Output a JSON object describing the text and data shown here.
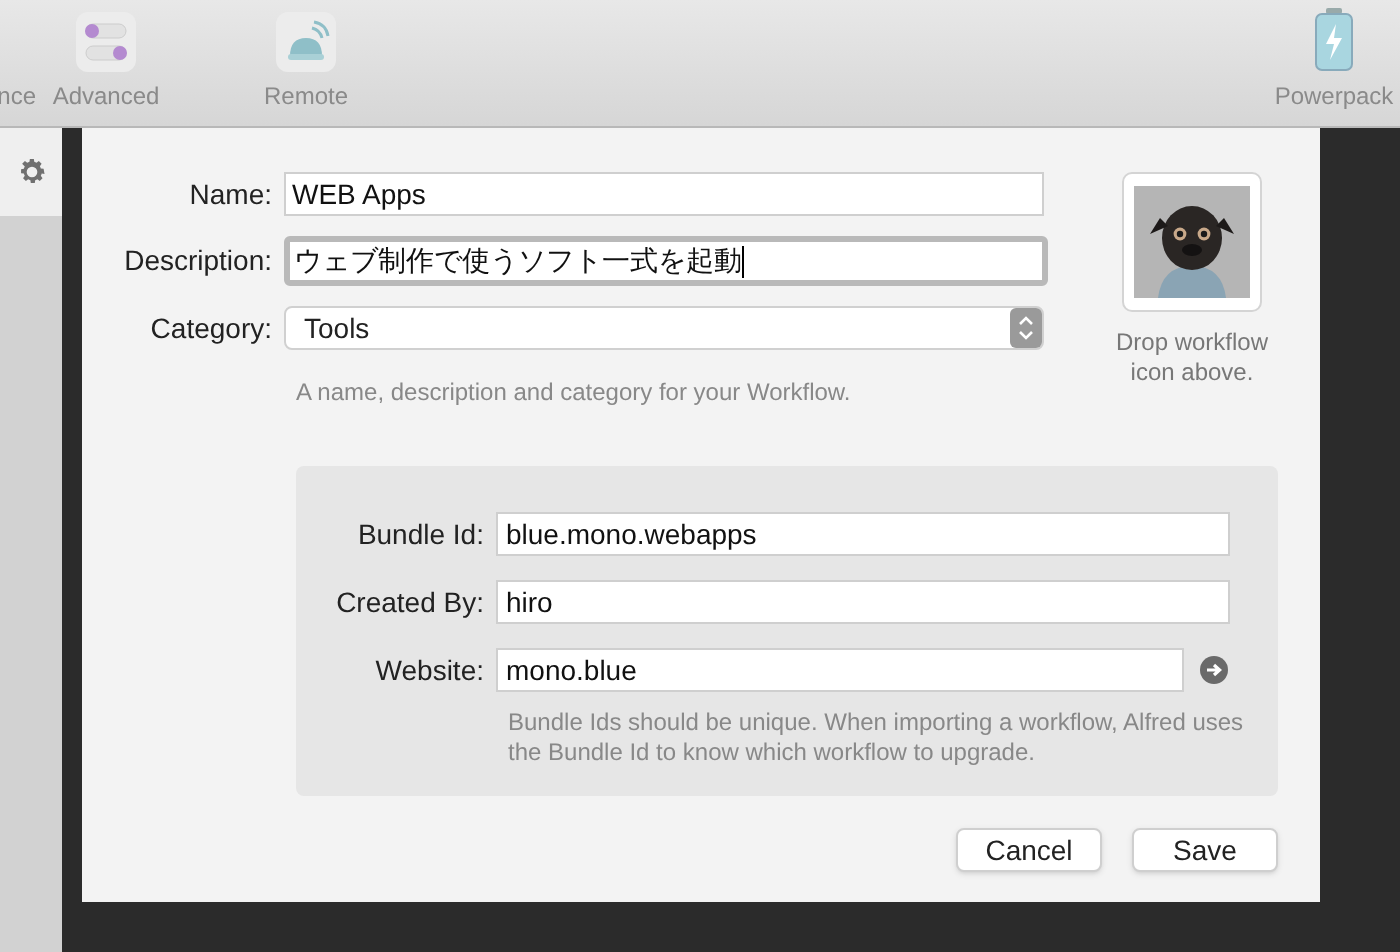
{
  "toolbar": {
    "items": [
      {
        "label": "nce",
        "kind": "none"
      },
      {
        "label": "Advanced",
        "kind": "toggles"
      },
      {
        "label": "Remote",
        "kind": "remote"
      },
      {
        "label": "Powerpack",
        "kind": "battery"
      }
    ]
  },
  "dialog": {
    "fields": [
      {
        "label": "Name:",
        "value": "WEB Apps",
        "kind": "text",
        "focused": false
      },
      {
        "label": "Description:",
        "value": "ウェブ制作で使うソフト一式を起動",
        "kind": "text",
        "focused": true
      },
      {
        "label": "Category:",
        "value": "Tools",
        "kind": "select",
        "focused": false
      }
    ],
    "hint": "A name, description and category for your Workflow.",
    "icon_well": {
      "caption": "Drop workflow icon above.",
      "kind": "picture"
    },
    "details": {
      "fields": [
        {
          "label": "Bundle Id:",
          "value": "blue.mono.webapps",
          "kind": "text"
        },
        {
          "label": "Created By:",
          "value": "hiro",
          "kind": "text"
        },
        {
          "label": "Website:",
          "value": "mono.blue",
          "kind": "link"
        }
      ],
      "note": "Bundle Ids should be unique. When importing a workflow, Alfred uses the Bundle Id to know which workflow to upgrade."
    },
    "buttons": [
      "Cancel",
      "Save"
    ]
  }
}
